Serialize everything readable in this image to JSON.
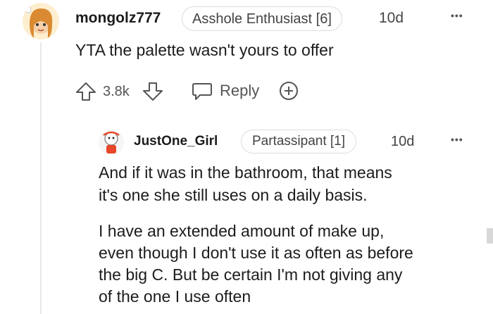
{
  "comment": {
    "username": "mongolz777",
    "flair": "Asshole Enthusiast [6]",
    "age": "10d",
    "more_label": "•••",
    "body": "YTA the palette wasn't yours to offer",
    "score": "3.8k",
    "reply_label": "Reply",
    "icons": [
      "upvote-icon",
      "downvote-icon",
      "reply-icon",
      "award-icon"
    ]
  },
  "reply": {
    "username": "JustOne_Girl",
    "flair": "Partassipant [1]",
    "age": "10d",
    "more_label": "•••",
    "paragraphs": [
      [
        "And if it was in the bathroom, that means",
        "it's one she still uses on a daily basis."
      ],
      [
        "I have an extended amount of make up,",
        "even though I don't use it as often as before",
        "the big C. But be certain I'm not giving any",
        "of the one I use often"
      ]
    ]
  },
  "colors": {
    "text": "#1c1c1c",
    "meta": "#444444",
    "flair_border": "#d9dcdf",
    "avatar1_hair": "#d98a32",
    "avatar2_accent": "#e8462a"
  }
}
